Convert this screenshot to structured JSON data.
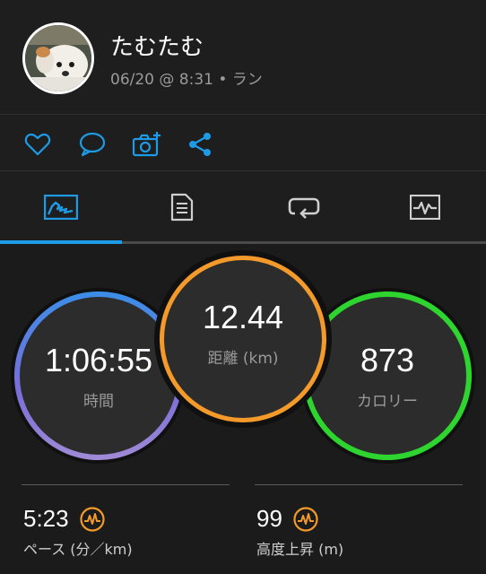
{
  "header": {
    "user_name": "たむたむ",
    "activity_meta": "06/20 @ 8:31 • ラン"
  },
  "actions": {
    "icons": [
      "heart-icon",
      "comment-icon",
      "add-photo-icon",
      "share-icon"
    ],
    "accent_color": "#1d9be6"
  },
  "tabs": {
    "items": [
      "overview-tab",
      "details-tab",
      "laps-tab",
      "charts-tab"
    ],
    "active": 0
  },
  "rings": {
    "time": {
      "value": "1:06:55",
      "label": "時間"
    },
    "distance": {
      "value": "12.44",
      "label": "距離 (km)"
    },
    "calories": {
      "value": "873",
      "label": "カロリー"
    }
  },
  "stats": {
    "pace": {
      "value": "5:23",
      "label": "ペース (分／km)"
    },
    "elevation": {
      "value": "99",
      "label": "高度上昇 (m)"
    }
  },
  "colors": {
    "time_ring": "#5b7fe0",
    "distance_ring": "#f39a2b",
    "calories_ring": "#2ed52e",
    "stat_icon": "#f39a2b"
  }
}
